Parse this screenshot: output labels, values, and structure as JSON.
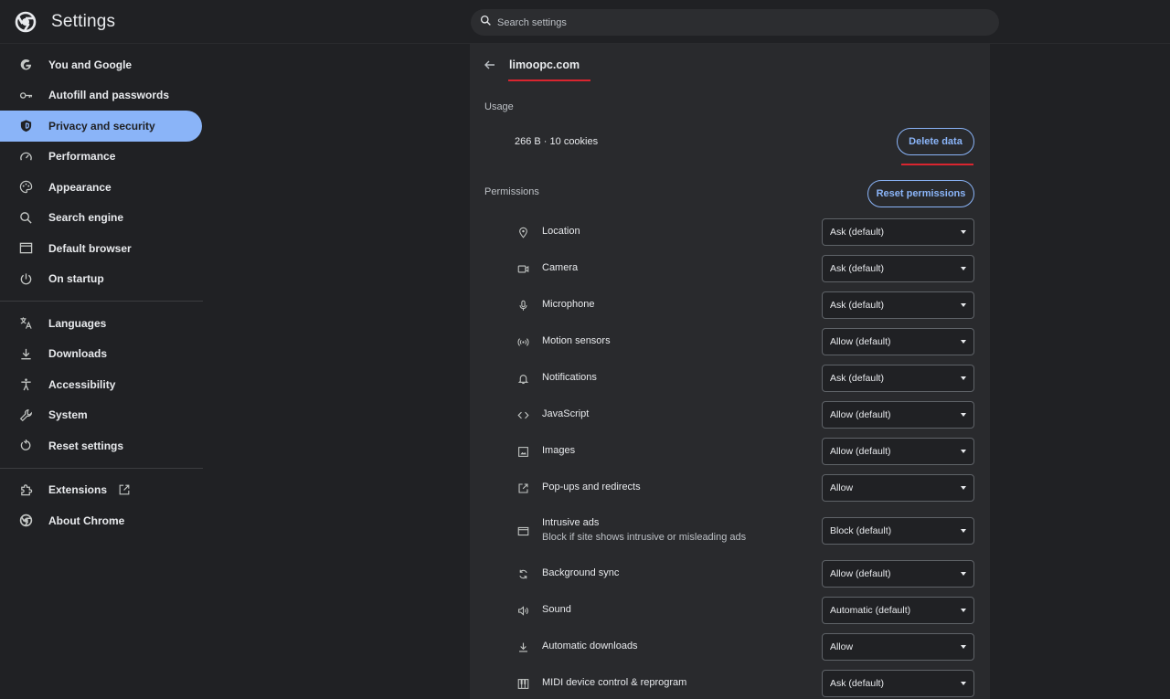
{
  "header": {
    "app_title": "Settings",
    "search_placeholder": "Search settings"
  },
  "sidebar": {
    "groups": [
      [
        {
          "label": "You and Google",
          "icon": "google-icon",
          "active": false
        },
        {
          "label": "Autofill and passwords",
          "icon": "key-icon",
          "active": false
        },
        {
          "label": "Privacy and security",
          "icon": "shield-icon",
          "active": true
        },
        {
          "label": "Performance",
          "icon": "speedometer-icon",
          "active": false
        },
        {
          "label": "Appearance",
          "icon": "palette-icon",
          "active": false
        },
        {
          "label": "Search engine",
          "icon": "search-icon",
          "active": false
        },
        {
          "label": "Default browser",
          "icon": "browser-window-icon",
          "active": false
        },
        {
          "label": "On startup",
          "icon": "power-icon",
          "active": false
        }
      ],
      [
        {
          "label": "Languages",
          "icon": "translate-icon",
          "active": false
        },
        {
          "label": "Downloads",
          "icon": "download-icon",
          "active": false
        },
        {
          "label": "Accessibility",
          "icon": "accessibility-icon",
          "active": false
        },
        {
          "label": "System",
          "icon": "wrench-icon",
          "active": false
        },
        {
          "label": "Reset settings",
          "icon": "reset-icon",
          "active": false
        }
      ],
      [
        {
          "label": "Extensions",
          "icon": "puzzle-icon",
          "active": false,
          "external": true
        },
        {
          "label": "About Chrome",
          "icon": "chrome-icon",
          "active": false
        }
      ]
    ]
  },
  "site": {
    "title": "limoopc.com",
    "usage_label": "Usage",
    "usage_value": "266 B · 10 cookies",
    "delete_label": "Delete data",
    "permissions_label": "Permissions",
    "reset_label": "Reset permissions"
  },
  "permissions": [
    {
      "label": "Location",
      "icon": "location-pin-icon",
      "value": "Ask (default)"
    },
    {
      "label": "Camera",
      "icon": "camera-icon",
      "value": "Ask (default)"
    },
    {
      "label": "Microphone",
      "icon": "microphone-icon",
      "value": "Ask (default)"
    },
    {
      "label": "Motion sensors",
      "icon": "motion-sensor-icon",
      "value": "Allow (default)"
    },
    {
      "label": "Notifications",
      "icon": "bell-icon",
      "value": "Ask (default)"
    },
    {
      "label": "JavaScript",
      "icon": "code-brackets-icon",
      "value": "Allow (default)"
    },
    {
      "label": "Images",
      "icon": "image-icon",
      "value": "Allow (default)"
    },
    {
      "label": "Pop-ups and redirects",
      "icon": "open-external-icon",
      "value": "Allow"
    },
    {
      "label": "Intrusive ads",
      "sub": "Block if site shows intrusive or misleading ads",
      "icon": "ad-frame-icon",
      "value": "Block (default)"
    },
    {
      "label": "Background sync",
      "icon": "sync-icon",
      "value": "Allow (default)"
    },
    {
      "label": "Sound",
      "icon": "speaker-icon",
      "value": "Automatic (default)"
    },
    {
      "label": "Automatic downloads",
      "icon": "download-icon",
      "value": "Allow"
    },
    {
      "label": "MIDI device control & reprogram",
      "icon": "piano-keys-icon",
      "value": "Ask (default)"
    }
  ],
  "colors": {
    "background": "#202124",
    "card": "#292a2d",
    "accent": "#8ab4f8",
    "annotation_red": "#d9252f"
  }
}
